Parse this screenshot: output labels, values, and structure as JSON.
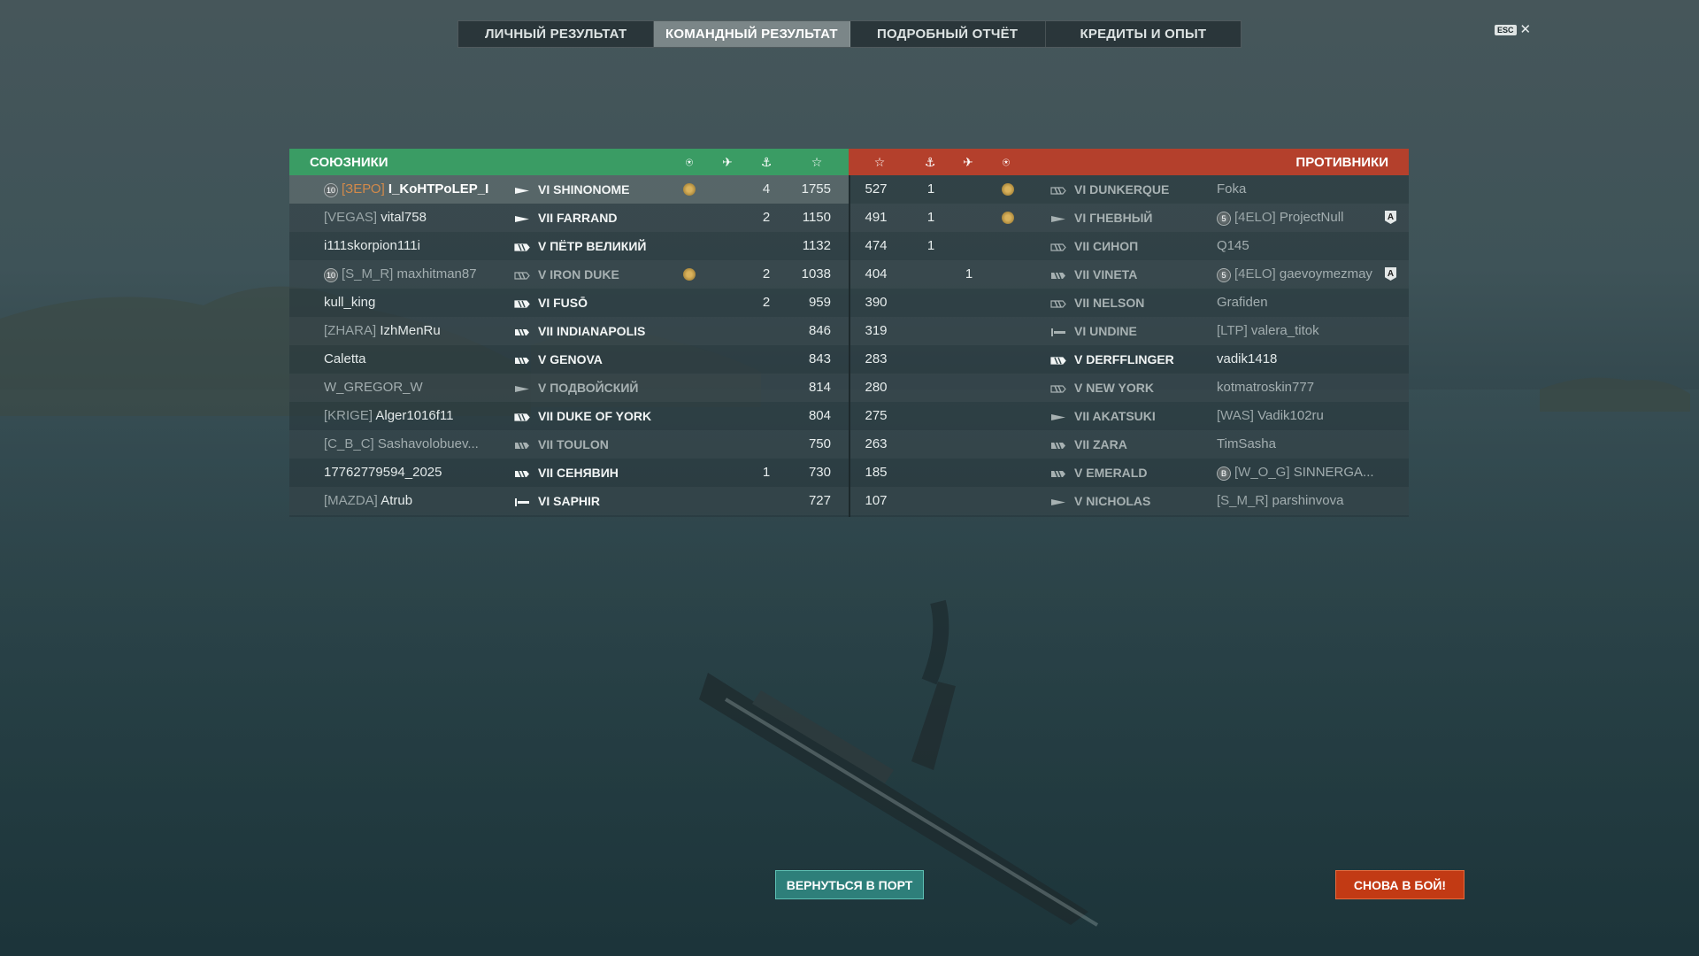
{
  "tabs": [
    {
      "label": "ЛИЧНЫЙ РЕЗУЛЬТАТ",
      "active": false
    },
    {
      "label": "КОМАНДНЫЙ РЕЗУЛЬТАТ",
      "active": true
    },
    {
      "label": "ПОДРОБНЫЙ ОТЧЁТ",
      "active": false
    },
    {
      "label": "КРЕДИТЫ И ОПЫТ",
      "active": false
    }
  ],
  "esc_label": "ESC",
  "close_symbol": "✕",
  "allies": {
    "title": "СОЮЗНИКИ",
    "header_icons": [
      "achievement-icon",
      "planes-icon",
      "kills-icon",
      "xp-star-icon"
    ],
    "rows": [
      {
        "emblem": "10",
        "clan": "[ЗЕРО]",
        "player": "I_KoHTPoLEP_I",
        "ship_icon": "destroyer-icon",
        "ship": "VI SHINONOME",
        "medal": true,
        "kills": "4",
        "xp": "1755",
        "me": true,
        "dead": false
      },
      {
        "emblem": "",
        "clan": "[VEGAS]",
        "player": "vital758",
        "ship_icon": "destroyer-icon",
        "ship": "VII FARRAND",
        "medal": false,
        "kills": "2",
        "xp": "1150",
        "me": false,
        "dead": false
      },
      {
        "emblem": "",
        "clan": "",
        "player": "i111skorpion111i",
        "ship_icon": "battleship-icon",
        "ship": "V ПЁТР ВЕЛИКИЙ",
        "medal": false,
        "kills": "",
        "xp": "1132",
        "me": false,
        "dead": false
      },
      {
        "emblem": "10",
        "clan": "[S_M_R]",
        "player": "maxhitman87",
        "ship_icon": "battleship-icon",
        "ship": "V IRON DUKE",
        "medal": true,
        "kills": "2",
        "xp": "1038",
        "me": false,
        "dead": true
      },
      {
        "emblem": "",
        "clan": "",
        "player": "kull_king",
        "ship_icon": "battleship-icon",
        "ship": "VI FUSŌ",
        "medal": false,
        "kills": "2",
        "xp": "959",
        "me": false,
        "dead": false
      },
      {
        "emblem": "",
        "clan": "[ZHARA]",
        "player": "IzhMenRu",
        "ship_icon": "cruiser-icon",
        "ship": "VII INDIANAPOLIS",
        "medal": false,
        "kills": "",
        "xp": "846",
        "me": false,
        "dead": false
      },
      {
        "emblem": "",
        "clan": "",
        "player": "Caletta",
        "ship_icon": "cruiser-icon",
        "ship": "V GENOVA",
        "medal": false,
        "kills": "",
        "xp": "843",
        "me": false,
        "dead": false
      },
      {
        "emblem": "",
        "clan": "",
        "player": "W_GREGOR_W",
        "ship_icon": "destroyer-icon",
        "ship": "V ПОДВОЙСКИЙ",
        "medal": false,
        "kills": "",
        "xp": "814",
        "me": false,
        "dead": true
      },
      {
        "emblem": "",
        "clan": "[KRIGE]",
        "player": "Alger1016f11",
        "ship_icon": "battleship-icon",
        "ship": "VII DUKE OF YORK",
        "medal": false,
        "kills": "",
        "xp": "804",
        "me": false,
        "dead": false
      },
      {
        "emblem": "",
        "clan": "[C_B_C]",
        "player": "Sashavolobuev...",
        "ship_icon": "cruiser-icon",
        "ship": "VII TOULON",
        "medal": false,
        "kills": "",
        "xp": "750",
        "me": false,
        "dead": true
      },
      {
        "emblem": "",
        "clan": "",
        "player": "17762779594_2025",
        "ship_icon": "cruiser-icon",
        "ship": "VII СЕНЯВИН",
        "medal": false,
        "kills": "1",
        "xp": "730",
        "me": false,
        "dead": false
      },
      {
        "emblem": "",
        "clan": "[MAZDA]",
        "player": "Atrub",
        "ship_icon": "carrier-icon",
        "ship": "VI SAPHIR",
        "medal": false,
        "kills": "",
        "xp": "727",
        "me": false,
        "dead": false
      }
    ]
  },
  "enemies": {
    "title": "ПРОТИВНИКИ",
    "header_icons": [
      "xp-star-icon",
      "kills-icon",
      "planes-icon",
      "achievement-icon"
    ],
    "rows": [
      {
        "xp": "527",
        "kills": "1",
        "planes": "",
        "medal": true,
        "ship_icon": "battleship-icon",
        "ship": "VI DUNKERQUE",
        "emblem": "",
        "clan": "",
        "player": "Foka",
        "rank_badge": "",
        "dead": true
      },
      {
        "xp": "491",
        "kills": "1",
        "planes": "",
        "medal": true,
        "ship_icon": "destroyer-icon",
        "ship": "VI ГНЕВНЫЙ",
        "emblem": "5",
        "clan": "[4ELO]",
        "player": "ProjectNull",
        "rank_badge": "A",
        "dead": true
      },
      {
        "xp": "474",
        "kills": "1",
        "planes": "",
        "medal": false,
        "ship_icon": "battleship-icon",
        "ship": "VII СИНОП",
        "emblem": "",
        "clan": "",
        "player": "Q145",
        "rank_badge": "",
        "dead": true
      },
      {
        "xp": "404",
        "kills": "",
        "planes": "1",
        "medal": false,
        "ship_icon": "cruiser-icon",
        "ship": "VII VINETA",
        "emblem": "5",
        "clan": "[4ELO]",
        "player": "gaevoymezmay",
        "rank_badge": "A",
        "dead": true
      },
      {
        "xp": "390",
        "kills": "",
        "planes": "",
        "medal": false,
        "ship_icon": "battleship-icon",
        "ship": "VII NELSON",
        "emblem": "",
        "clan": "",
        "player": "Grafiden",
        "rank_badge": "",
        "dead": true
      },
      {
        "xp": "319",
        "kills": "",
        "planes": "",
        "medal": false,
        "ship_icon": "carrier-icon",
        "ship": "VI UNDINE",
        "emblem": "",
        "clan": "[LTP]",
        "player": "valera_titok",
        "rank_badge": "",
        "dead": true
      },
      {
        "xp": "283",
        "kills": "",
        "planes": "",
        "medal": false,
        "ship_icon": "battleship-icon",
        "ship": "V DERFFLINGER",
        "emblem": "",
        "clan": "",
        "player": "vadik1418",
        "rank_badge": "",
        "dead": false
      },
      {
        "xp": "280",
        "kills": "",
        "planes": "",
        "medal": false,
        "ship_icon": "battleship-icon",
        "ship": "V NEW YORK",
        "emblem": "",
        "clan": "",
        "player": "kotmatroskin777",
        "rank_badge": "",
        "dead": true
      },
      {
        "xp": "275",
        "kills": "",
        "planes": "",
        "medal": false,
        "ship_icon": "destroyer-icon",
        "ship": "VII AKATSUKI",
        "emblem": "",
        "clan": "[WAS]",
        "player": "Vadik102ru",
        "rank_badge": "",
        "dead": true
      },
      {
        "xp": "263",
        "kills": "",
        "planes": "",
        "medal": false,
        "ship_icon": "cruiser-icon",
        "ship": "VII ZARA",
        "emblem": "",
        "clan": "",
        "player": "TimSasha",
        "rank_badge": "",
        "dead": true
      },
      {
        "xp": "185",
        "kills": "",
        "planes": "",
        "medal": false,
        "ship_icon": "cruiser-icon",
        "ship": "V EMERALD",
        "emblem": "B",
        "clan": "[W_O_G]",
        "player": "SINNERGA...",
        "rank_badge": "",
        "dead": true
      },
      {
        "xp": "107",
        "kills": "",
        "planes": "",
        "medal": false,
        "ship_icon": "destroyer-icon",
        "ship": "V NICHOLAS",
        "emblem": "",
        "clan": "[S_M_R]",
        "player": "parshinvova",
        "rank_badge": "",
        "dead": true
      }
    ]
  },
  "buttons": {
    "port": "ВЕРНУТЬСЯ В ПОРТ",
    "again": "СНОВА В БОЙ!"
  },
  "colors": {
    "ally_header": "#3a9c64",
    "enemy_header": "#b4402c",
    "own_clan": "#d38a4a",
    "port_button": "#2e7f7a",
    "battle_button": "#c23a14"
  }
}
